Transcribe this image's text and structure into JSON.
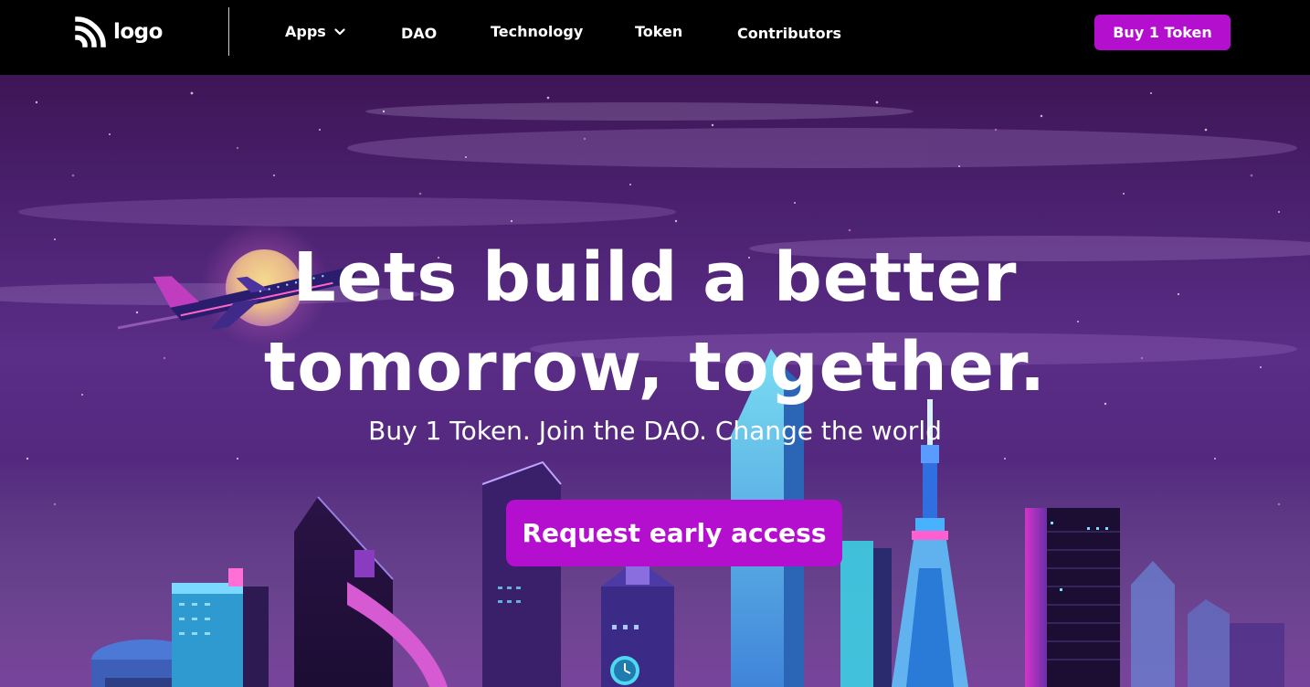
{
  "nav": {
    "logo_text": "logo",
    "links": [
      "Apps",
      "DAO",
      "Technology",
      "Token",
      "Contributors"
    ],
    "buy_button": "Buy 1 Token"
  },
  "hero": {
    "headline_line1": "Lets build a better",
    "headline_line2": "tomorrow, together.",
    "subheadline": "Buy 1 Token. Join the DAO. Change the world",
    "cta_button": "Request early access"
  },
  "colors": {
    "accent": "#b40fcf",
    "nav_background": "#000000",
    "hero_purple": "#4b2170"
  },
  "icons": {
    "logo": "rss-style-arcs-logo-icon",
    "apps_dropdown": "chevron-down-icon"
  }
}
